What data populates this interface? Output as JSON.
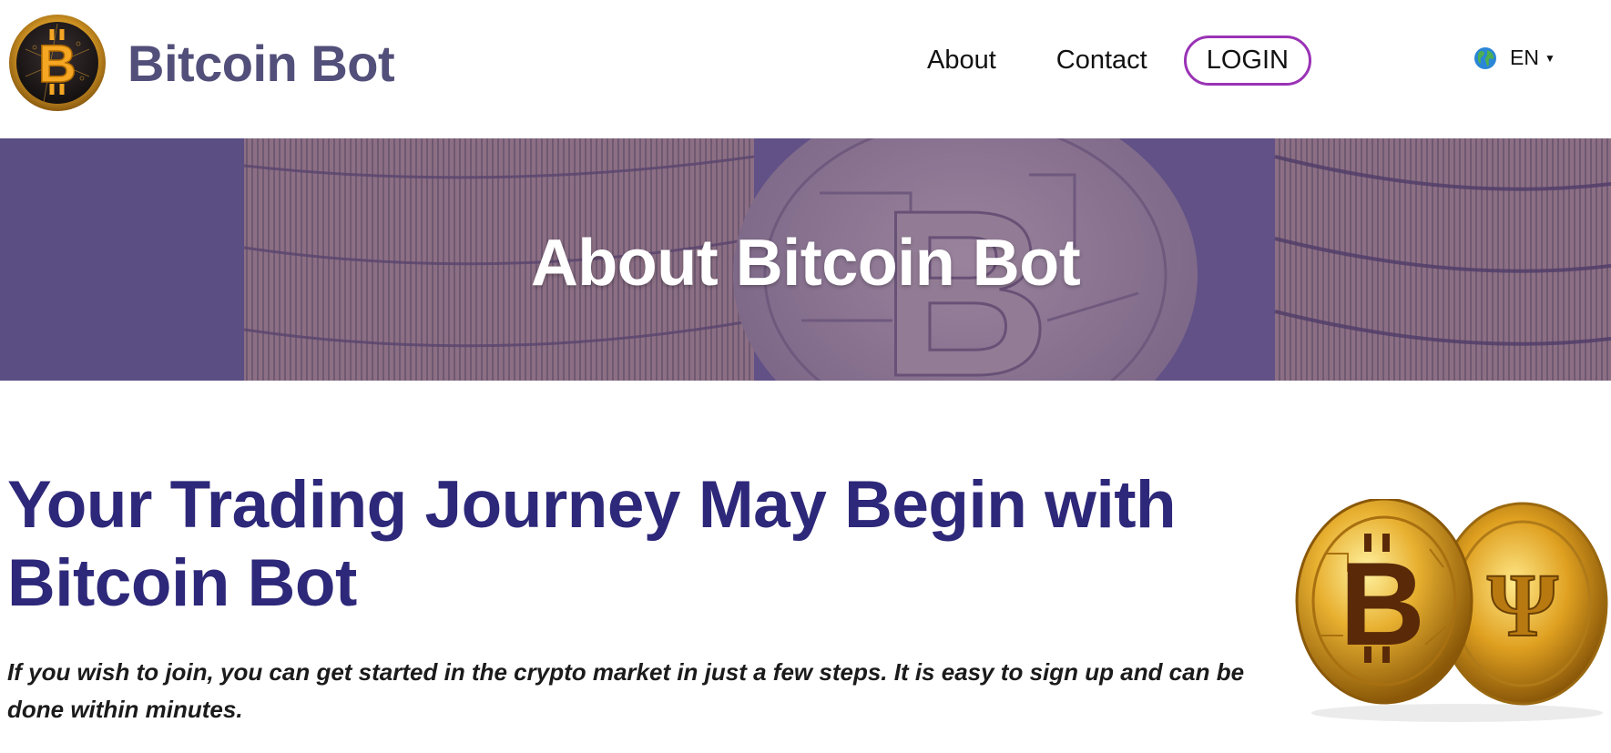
{
  "header": {
    "brand": "Bitcoin Bot",
    "nav": {
      "about": "About",
      "contact": "Contact",
      "login": "LOGIN"
    },
    "language": "EN"
  },
  "hero": {
    "title": "About Bitcoin Bot"
  },
  "main": {
    "heading": "Your Trading Journey May Begin with Bitcoin Bot",
    "intro": "If you wish to join, you can get started in the crypto market in just a few steps. It is easy to sign up and can be done within minutes."
  },
  "colors": {
    "brand_text": "#52507a",
    "heading": "#2d2879",
    "login_border": "#9a33b6",
    "hero_overlay": "#5a4a80"
  },
  "icons": [
    "bitcoin-logo-icon",
    "globe-icon",
    "caret-down-icon"
  ]
}
